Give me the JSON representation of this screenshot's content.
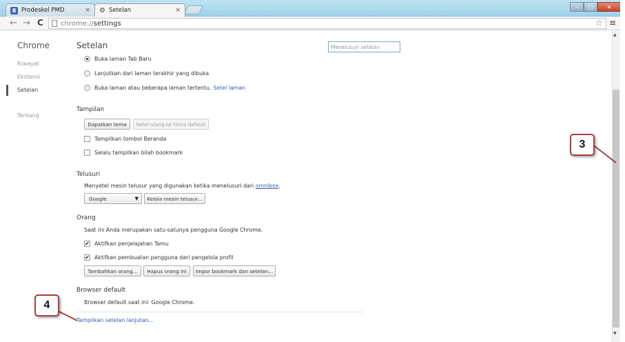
{
  "browser": {
    "tabs": [
      {
        "title": "Prodeskel PMD",
        "favicon": "8",
        "close": "×"
      },
      {
        "title": "Setelan",
        "close": "×"
      }
    ],
    "window_buttons": {
      "minimize": "–",
      "maximize": "□",
      "close": "✕"
    },
    "nav": {
      "back": "←",
      "forward": "→",
      "reload": "C"
    },
    "url_scheme": "chrome://",
    "url_path": "settings",
    "star": "☆",
    "menu": "≡"
  },
  "sidebar": {
    "title": "Chrome",
    "items": [
      {
        "label": "Riwayat"
      },
      {
        "label": "Ekstensi"
      },
      {
        "label": "Setelan"
      },
      {
        "label": "Tentang"
      }
    ]
  },
  "main": {
    "title": "Setelan",
    "search_placeholder": "Menelusuri setelan",
    "startup": {
      "option1": "Buka laman Tab Baru",
      "option2": "Lanjutkan dari laman terakhir yang dibuka",
      "option3": "Buka laman atau beberapa laman tertentu.",
      "option3_link": "Setel laman"
    },
    "appearance": {
      "title": "Tampilan",
      "get_themes": "Dapatkan tema",
      "reset_theme": "Setel ulang ke tema default",
      "show_home": "Tampilkan tombol Beranda",
      "show_bookmarks": "Selalu tampilkan bilah bookmark"
    },
    "search": {
      "title": "Telusuri",
      "desc": "Menyetel mesin telusur yang digunakan ketika menelusuri dari",
      "desc_link": "omnibox",
      "desc_end": ".",
      "engine": "Google",
      "caret": "▼",
      "manage": "Kelola mesin telusur..."
    },
    "people": {
      "title": "Orang",
      "desc": "Saat ini Anda merupakan satu-satunya pengguna Google Chrome.",
      "guest": "Aktifkan penjelajahan Tamu",
      "supervised": "Aktifkan pembuatan pengguna dari pengelola profil",
      "add": "Tambahkan orang...",
      "remove": "Hapus orang ini",
      "import": "Impor bookmark dan setelan..."
    },
    "default_browser": {
      "title": "Browser default",
      "desc": "Browser default saat ini: Google Chrome."
    },
    "advanced_link": "Tampilkan setelan lanjutan..."
  },
  "annotations": {
    "callout_3": "3",
    "callout_4": "4",
    "color": "#a34040"
  },
  "checkmark": "✔"
}
